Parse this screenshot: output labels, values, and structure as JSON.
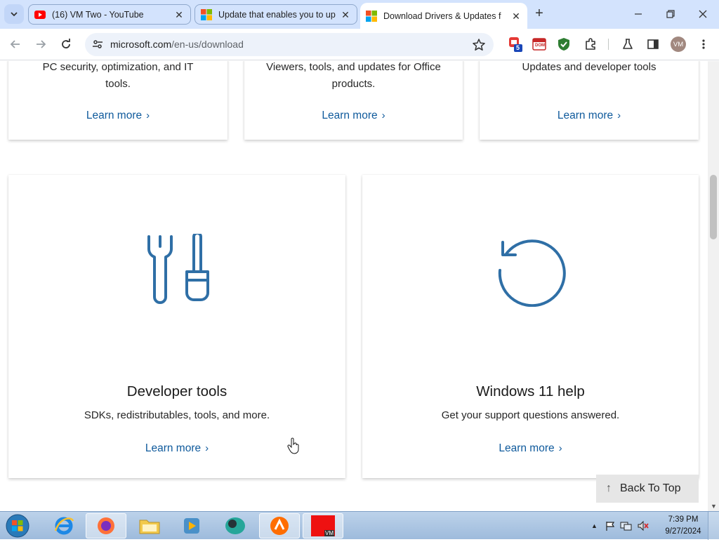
{
  "browser": {
    "tabs": [
      {
        "title": "(16) VM Two - YouTube",
        "favicon": "youtube-icon"
      },
      {
        "title": "Update that enables you to up",
        "favicon": "microsoft-logo-icon"
      },
      {
        "title": "Download Drivers & Updates f",
        "favicon": "microsoft-logo-icon"
      }
    ],
    "address": {
      "host": "microsoft.com",
      "path": "/en-us/download"
    },
    "profile_initials": "VM",
    "extension_badge": "5",
    "extension_label": "DOM"
  },
  "top_cards": [
    {
      "desc_line1": "PC security, optimization, and IT",
      "desc_line2": "tools.",
      "link": "Learn more"
    },
    {
      "desc_line1": "Viewers, tools, and updates for Office",
      "desc_line2": "products.",
      "link": "Learn more"
    },
    {
      "desc_line1": "Updates and developer tools",
      "desc_line2": "",
      "link": "Learn more"
    }
  ],
  "feature_cards": [
    {
      "title": "Developer tools",
      "desc": "SDKs, redistributables, tools, and more.",
      "link": "Learn more",
      "icon": "wrench-screwdriver-icon"
    },
    {
      "title": "Windows 11 help",
      "desc": "Get your support questions answered.",
      "link": "Learn more",
      "icon": "refresh-circle-icon"
    }
  ],
  "back_to_top": "Back To Top",
  "taskbar": {
    "time": "7:39 PM",
    "date": "9/27/2024",
    "recorder_label": "VM"
  },
  "colors": {
    "accent_link": "#0f5a9c",
    "icon_blue": "#2f6fa6",
    "tabstrip": "#d3e3fd"
  }
}
